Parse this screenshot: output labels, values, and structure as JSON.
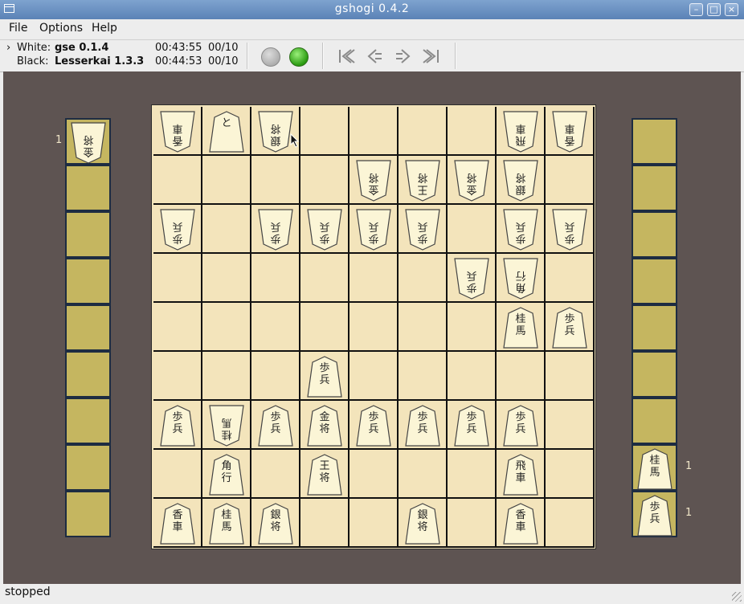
{
  "window": {
    "title": "gshogi 0.4.2"
  },
  "menu": [
    "File",
    "Options",
    "Help"
  ],
  "players": {
    "white": {
      "prefix": "White:",
      "name": "gse 0.1.4",
      "clock": "00:43:55",
      "moves": "00/10"
    },
    "black": {
      "prefix": "Black:",
      "name": "Lesserkai 1.3.3",
      "clock": "00:44:53",
      "moves": "00/10"
    }
  },
  "toolbar": {
    "stop_lamp": "gray",
    "go_lamp": "green"
  },
  "board": {
    "rows": [
      [
        {
          "t": "香\n車",
          "o": "g"
        },
        {
          "t": "と",
          "o": "s"
        },
        {
          "t": "銀\n将",
          "o": "g"
        },
        null,
        null,
        null,
        null,
        {
          "t": "飛\n車",
          "o": "g"
        },
        {
          "t": "香\n車",
          "o": "g"
        }
      ],
      [
        null,
        null,
        null,
        null,
        {
          "t": "金\n将",
          "o": "g"
        },
        {
          "t": "王\n将",
          "o": "g"
        },
        {
          "t": "金\n将",
          "o": "g"
        },
        {
          "t": "銀\n将",
          "o": "g"
        },
        null
      ],
      [
        {
          "t": "歩\n兵",
          "o": "g"
        },
        null,
        {
          "t": "歩\n兵",
          "o": "g"
        },
        {
          "t": "歩\n兵",
          "o": "g"
        },
        {
          "t": "歩\n兵",
          "o": "g"
        },
        {
          "t": "歩\n兵",
          "o": "g"
        },
        null,
        {
          "t": "歩\n兵",
          "o": "g"
        },
        {
          "t": "歩\n兵",
          "o": "g"
        }
      ],
      [
        null,
        null,
        null,
        null,
        null,
        null,
        {
          "t": "歩\n兵",
          "o": "g"
        },
        {
          "t": "角\n行",
          "o": "g"
        },
        null
      ],
      [
        null,
        null,
        null,
        null,
        null,
        null,
        null,
        {
          "t": "桂\n馬",
          "o": "s"
        },
        {
          "t": "歩\n兵",
          "o": "s"
        }
      ],
      [
        null,
        null,
        null,
        {
          "t": "歩\n兵",
          "o": "s"
        },
        null,
        null,
        null,
        null,
        null
      ],
      [
        {
          "t": "歩\n兵",
          "o": "s"
        },
        {
          "t": "桂\n馬",
          "o": "g"
        },
        {
          "t": "歩\n兵",
          "o": "s"
        },
        {
          "t": "金\n将",
          "o": "s"
        },
        {
          "t": "歩\n兵",
          "o": "s"
        },
        {
          "t": "歩\n兵",
          "o": "s"
        },
        {
          "t": "歩\n兵",
          "o": "s"
        },
        {
          "t": "歩\n兵",
          "o": "s"
        },
        null
      ],
      [
        null,
        {
          "t": "角\n行",
          "o": "s"
        },
        null,
        {
          "t": "王\n将",
          "o": "s"
        },
        null,
        null,
        null,
        {
          "t": "飛\n車",
          "o": "s"
        },
        null
      ],
      [
        {
          "t": "香\n車",
          "o": "s"
        },
        {
          "t": "桂\n馬",
          "o": "s"
        },
        {
          "t": "銀\n将",
          "o": "s"
        },
        null,
        null,
        {
          "t": "銀\n将",
          "o": "s"
        },
        null,
        {
          "t": "香\n車",
          "o": "s"
        },
        null
      ]
    ]
  },
  "white_hand": [
    {
      "t": "金\n将",
      "count": "1"
    }
  ],
  "black_hand": [
    {
      "t": "桂\n馬",
      "count": "1"
    },
    {
      "t": "歩\n兵",
      "count": "1"
    }
  ],
  "status": "stopped"
}
